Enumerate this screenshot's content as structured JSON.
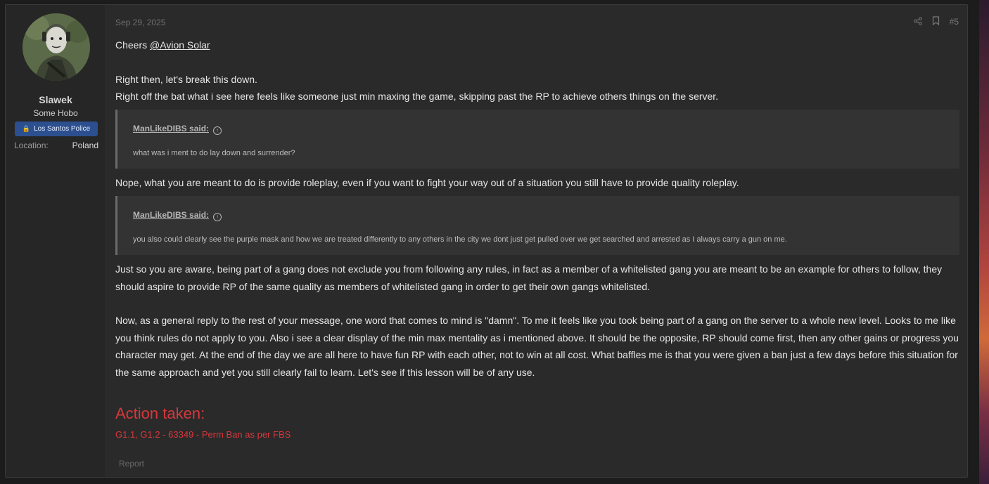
{
  "post": {
    "date": "Sep 29, 2025",
    "number": "#5",
    "icons": {
      "share": "share-icon",
      "bookmark": "bookmark-icon"
    },
    "report_label": "Report"
  },
  "user": {
    "name": "Slawek",
    "title": "Some Hobo",
    "banner": "Los Santos Police",
    "location_label": "Location:",
    "location_value": "Poland"
  },
  "content": {
    "greeting": "Cheers ",
    "mention": "@Avion Solar",
    "p1": "Right then, let's break this down.",
    "p2": "Right off the bat what i see here feels like someone just min maxing the game, skipping past the RP to achieve others things on the server.",
    "quote1": {
      "author": "ManLikeDIBS said:",
      "text": "what was i ment to do lay down and surrender?"
    },
    "p3": "Nope, what you are meant to do is provide roleplay, even if you want to fight your way out of a situation you still have to provide quality roleplay.",
    "quote2": {
      "author": "ManLikeDIBS said:",
      "text": "you also could clearly see the purple mask and how we are treated differently to any others in the city we dont just get pulled over we get searched and arrested as I always carry a gun on me."
    },
    "p4": "Just so you are aware, being part of a gang does not exclude you from following any rules, in fact as a member of a whitelisted gang you are meant to be an example for others to follow, they should aspire to provide RP of the same quality as members of whitelisted gang in order to get their own gangs whitelisted.",
    "p5": "Now, as a general reply to the rest of your message, one word that comes to mind is \"damn\". To me it feels like you took being part of a gang on the server to a whole new level. Looks to me like you think rules do not apply to you. Also i see a clear display of the min max mentality as i mentioned above. It should be the opposite, RP should come first, then any other gains or progress you character may get. At the end of the day we are all here to have fun RP with each other, not to win at all cost. What baffles me is that you were given a ban just a few days before this situation for the same approach and yet you still clearly fail to learn. Let's see if this lesson will be of any use.",
    "action_title": "Action taken:",
    "action_text": "G1.1, G1.2 - 63349 - Perm Ban as per FBS"
  },
  "colors": {
    "background": "#1c1c1c",
    "post_bg": "#2a2a2a",
    "banner_bg": "#2c4f8f",
    "action_red": "#d9373b"
  }
}
